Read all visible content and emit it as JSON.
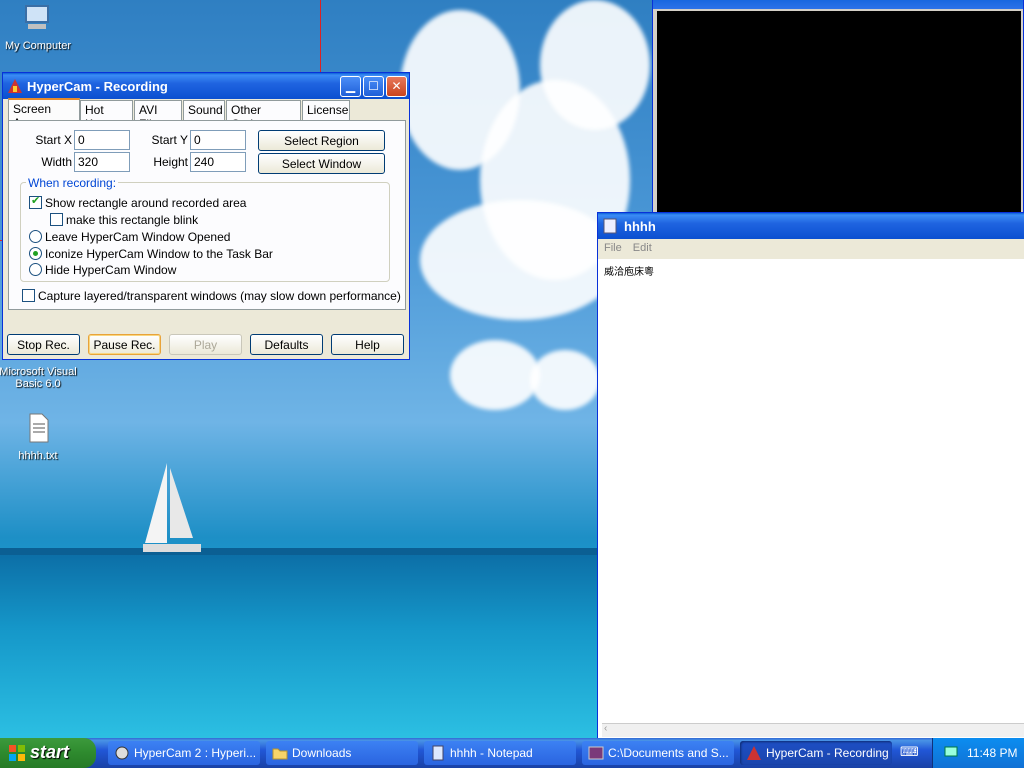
{
  "desktop": {
    "icons": [
      {
        "label": "My Computer"
      },
      {
        "label": "Microsoft Visual Basic 6.0"
      },
      {
        "label": "hhhh.txt"
      }
    ]
  },
  "hypercam": {
    "title": "HyperCam - Recording",
    "tabs": [
      "Screen Area",
      "Hot Keys",
      "AVI File",
      "Sound",
      "Other Options",
      "License"
    ],
    "start_x_label": "Start X",
    "start_x_value": "0",
    "start_y_label": "Start Y",
    "start_y_value": "0",
    "width_label": "Width",
    "width_value": "320",
    "height_label": "Height",
    "height_value": "240",
    "select_region": "Select Region",
    "select_window": "Select Window",
    "when_recording": "When recording:",
    "opt_show_rect": "Show rectangle around recorded area",
    "opt_blink": "make this rectangle blink",
    "opt_leave_open": "Leave HyperCam Window Opened",
    "opt_iconize": "Iconize HyperCam Window to the Task Bar",
    "opt_hide": "Hide HyperCam Window",
    "opt_layered": "Capture layered/transparent windows (may slow down performance)",
    "buttons": [
      "Stop Rec.",
      "Pause Rec.",
      "Play",
      "Defaults",
      "Help"
    ]
  },
  "notepad": {
    "title": "hhhh",
    "menu": [
      "File",
      "Edit"
    ],
    "content": "威洽庖床粵"
  },
  "taskbar": {
    "start_label": "start",
    "tasks": [
      "HyperCam 2 : Hyperi...",
      "Downloads",
      "hhhh - Notepad",
      "C:\\Documents and S...",
      "HyperCam - Recording"
    ],
    "clock": "11:48 PM"
  },
  "colors": {
    "xp_blue": "#0831d9",
    "start_green": "#2e8a2e",
    "record_rect": "#d22"
  }
}
